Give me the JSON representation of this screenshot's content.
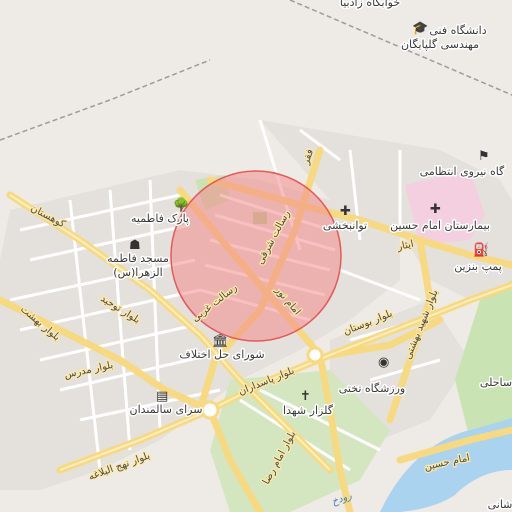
{
  "colors": {
    "land": "#eeeae6",
    "block": "#e2ded9",
    "green": "#c9e3b3",
    "hospital": "#f7cfe0",
    "water": "#aad3f0",
    "major_road": "#f7d980",
    "minor_road": "#ffffff",
    "highlight_fill": "#f28c8c",
    "highlight_stroke": "#e35a5a",
    "rail": "#9a9a9a"
  },
  "labels": {
    "university_1": "دانشگاه فنی",
    "university_2": "مهندسی گلپایگان",
    "top_cut": "خوابگاه زادبیا",
    "police": "گاه نیروی انتظامی",
    "hospital": "بیمارستان امام حسین",
    "tavanbakhshi": "توانبخشی",
    "pump": "پمپ بنزین",
    "park": "پارک فاطمیه",
    "mosque_1": "مسجد فاطمه",
    "mosque_2": "الزهرا(س)",
    "council": "شورای حل اختلاف",
    "stadium": "ورزشگاه تختی",
    "elderly": "سرای سالمندان",
    "martyrs": "گلزار شهدا",
    "bahar": "ساحلی",
    "tashi": "شانی"
  },
  "roads": {
    "kuhestan": "کوهستان",
    "tohid": "بلوار توحید",
    "modares": "بلوار مدرس",
    "behesht": "بلوار بهشت",
    "resalat_gharbi": "رسالت غربی",
    "resalat_sharghi": "رسالت شرقی",
    "imam_noor": "امام نور",
    "faqr": "فقر",
    "boostan": "بلوار بوستان",
    "shahid_beheshti": "بلوار شهید بهشتی",
    "pasdaran": "بلوار پاسداران",
    "imam_reza": "بلوار امام رضا",
    "nahj": "بلوار نهج البلاغه",
    "imam_hossein": "امام حسین",
    "ishar": "ایثار"
  },
  "water": {
    "river": "رودخ"
  },
  "icons": [
    "park-tree-icon",
    "mosque-icon",
    "government-icon",
    "hospital-cross-icon",
    "fuel-icon",
    "police-icon",
    "stadium-icon",
    "cemetery-icon",
    "elderly-home-icon",
    "university-icon"
  ]
}
